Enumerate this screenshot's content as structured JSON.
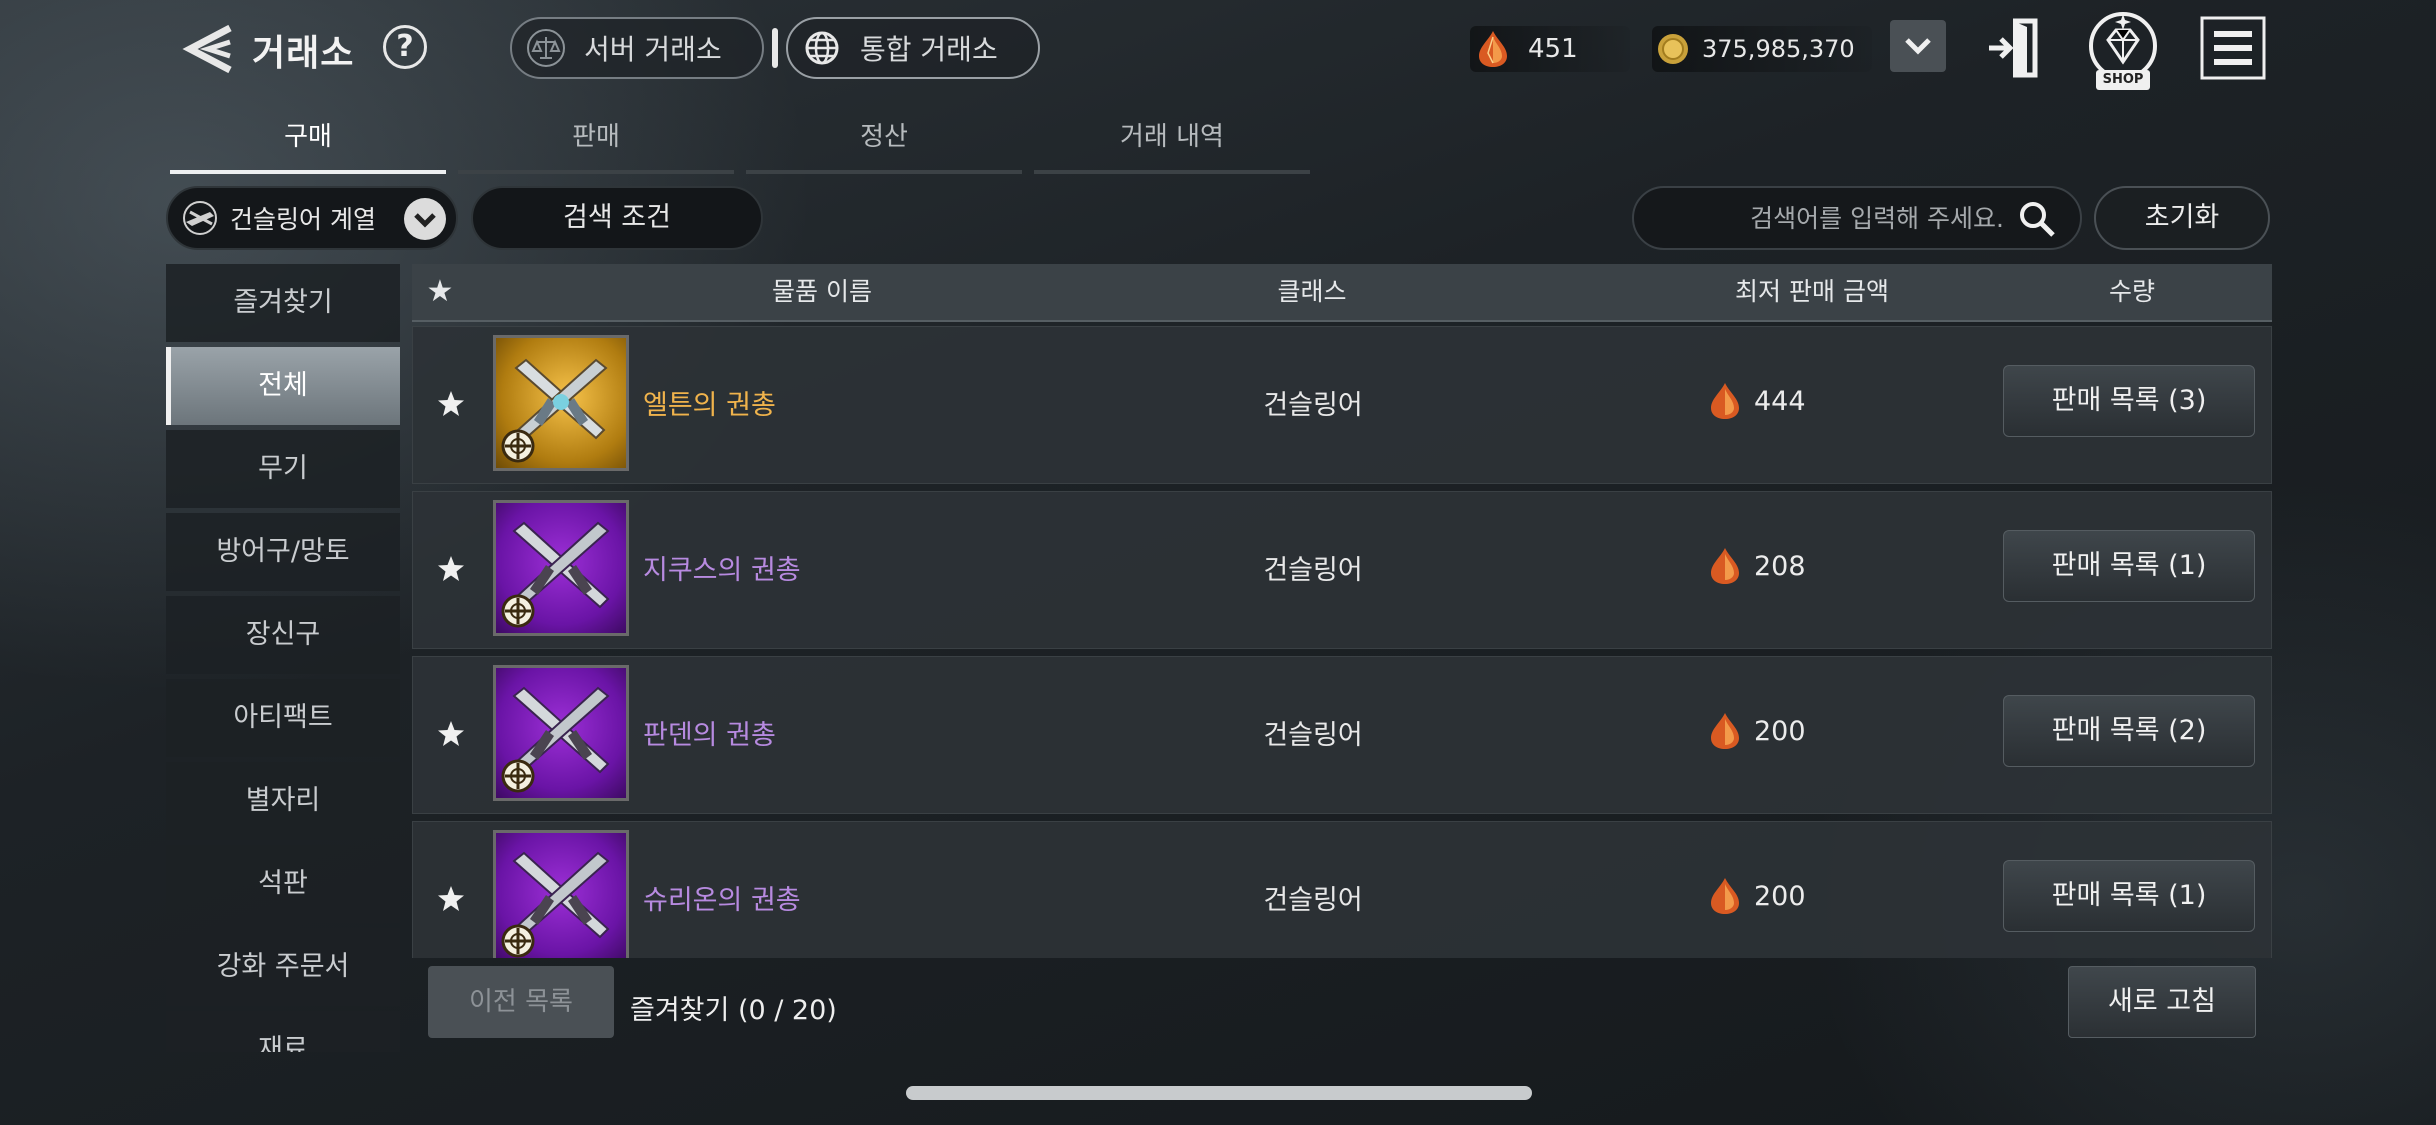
{
  "header": {
    "title": "거래소",
    "help": "?",
    "server_exchange": "서버 거래소",
    "unified_exchange": "통합 거래소",
    "gem_amount": "451",
    "gold_amount": "375,985,370",
    "shop_label": "SHOP"
  },
  "tabs": [
    "구매",
    "판매",
    "정산",
    "거래 내역"
  ],
  "filters": {
    "class_select": "건슬링어 계열",
    "search_conditions": "검색 조건",
    "search_placeholder": "검색어를 입력해 주세요.",
    "reset": "초기화"
  },
  "sidebar": {
    "items": [
      "즐겨찾기",
      "전체",
      "무기",
      "방어구/망토",
      "장신구",
      "아티팩트",
      "별자리",
      "석판",
      "강화 주문서",
      "재료"
    ],
    "active_index": 1
  },
  "table": {
    "headers": {
      "star": "★",
      "name": "물품 이름",
      "class": "클래스",
      "lowest_price": "최저 판매 금액",
      "quantity": "수량"
    },
    "rows": [
      {
        "name": "엘튼의 권총",
        "grade": "gold",
        "class": "건슬링어",
        "price": "444",
        "action": "판매 목록 (3)"
      },
      {
        "name": "지쿠스의 권총",
        "grade": "purple",
        "class": "건슬링어",
        "price": "208",
        "action": "판매 목록 (1)"
      },
      {
        "name": "판덴의 권총",
        "grade": "purple",
        "class": "건슬링어",
        "price": "200",
        "action": "판매 목록 (2)"
      },
      {
        "name": "슈리온의 권총",
        "grade": "purple",
        "class": "건슬링어",
        "price": "200",
        "action": "판매 목록 (1)"
      }
    ]
  },
  "footer": {
    "prev_list": "이전 목록",
    "favorites": "즐겨찾기 (0 / 20)",
    "refresh": "새로 고침"
  },
  "colors": {
    "gold_grade": "#f0b34c",
    "purple_grade": "#b78ae0",
    "accent_tab": "#eef0f1"
  }
}
